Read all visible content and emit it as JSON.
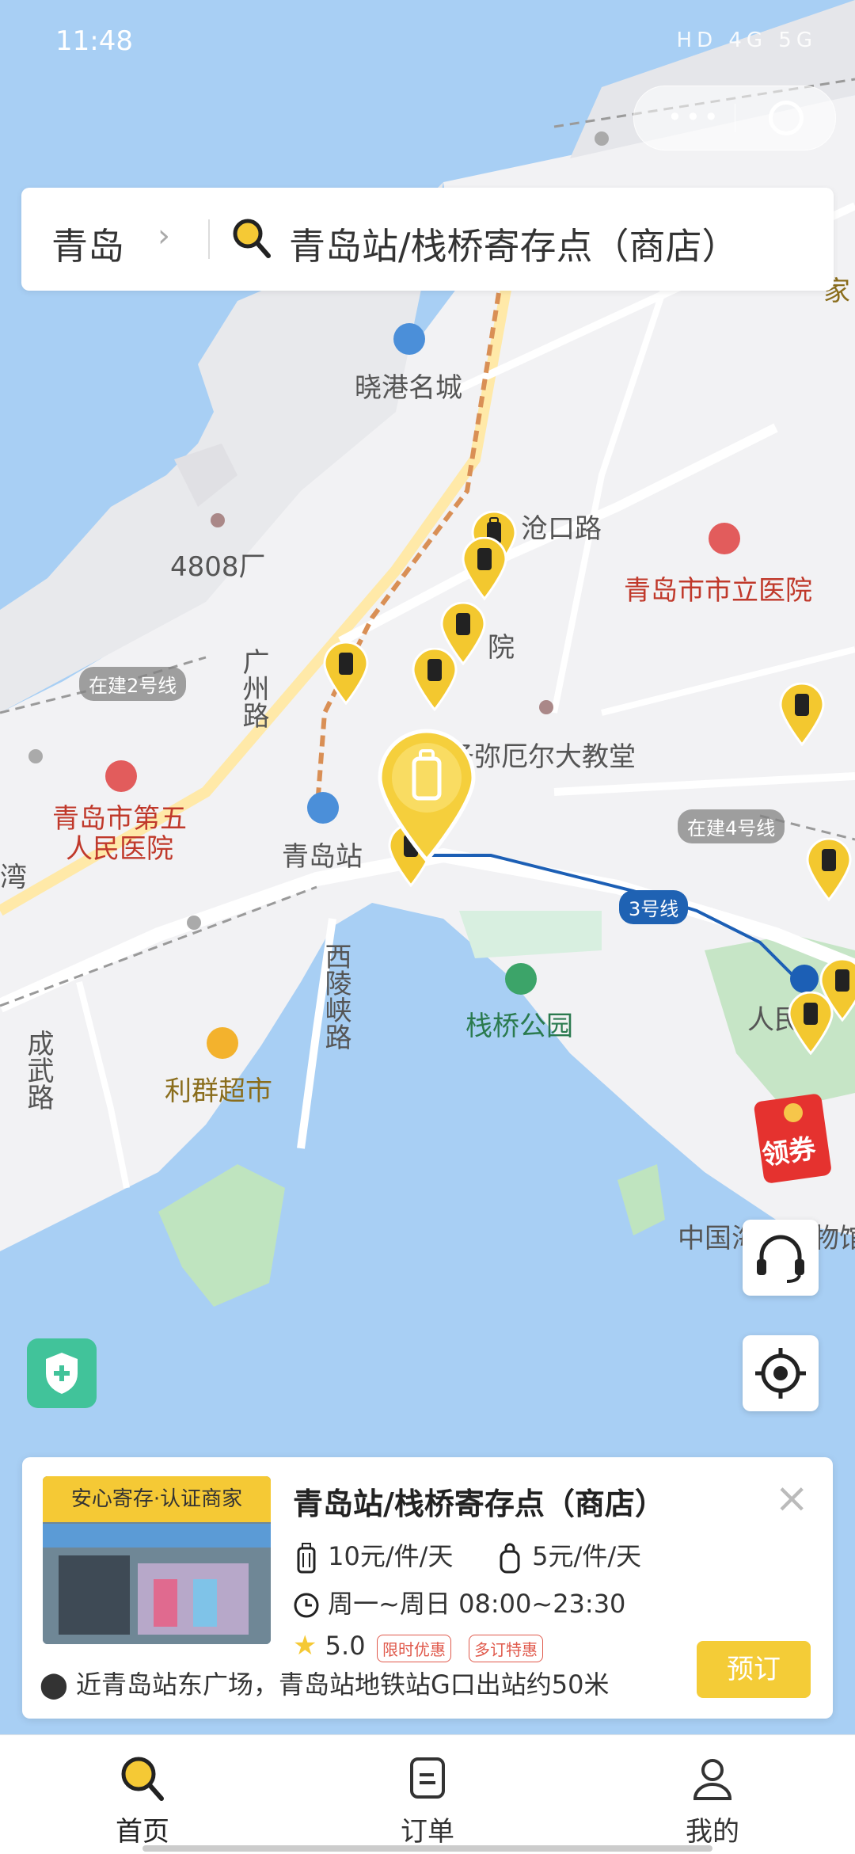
{
  "status_bar": {
    "time": "11:48",
    "indicators": "HD 4G 5G"
  },
  "capsule": {
    "more_icon": "more-dots-icon",
    "close_icon": "target-ring-icon"
  },
  "search": {
    "city": "青岛",
    "query": "青岛站/栈桥寄存点（商店）"
  },
  "map": {
    "labels": {
      "xiaogang": "晓港名城",
      "factory": "4808厂",
      "canglu": "沧口路",
      "hospital_city": "青岛市市立医院",
      "line2": "在建2号线",
      "guangzhou_rd": "广州路",
      "yuan": "院",
      "church": "圣弥厄尔大教堂",
      "hospital5": "青岛市第五\n人民医院",
      "station": "青岛站",
      "line4": "在建4号线",
      "line3": "3号线",
      "xiling": "西陵峡路",
      "park": "栈桥公园",
      "renmin": "人民",
      "chengwu": "成武路",
      "liqun": "利群超市",
      "museum": "中国海军博物馆",
      "jiangong": "家",
      "wan": "湾"
    }
  },
  "red_packet": {
    "label": "领券"
  },
  "controls": {
    "support_icon": "headset-icon",
    "locate_icon": "locate-icon",
    "safety_icon": "shield-plus-icon"
  },
  "card": {
    "badge": "安心寄存·认证商家",
    "title": "青岛站/栈桥寄存点（商店）",
    "price_luggage": "10元/件/天",
    "price_bag": "5元/件/天",
    "hours": "周一~周日 08:00~23:30",
    "rating": "5.0",
    "tags": [
      "限时优惠",
      "多订特惠"
    ],
    "address": "近青岛站东广场，青岛站地铁站G口出站约50米",
    "book": "预订"
  },
  "tabs": [
    {
      "label": "首页",
      "icon": "search-icon",
      "active": true
    },
    {
      "label": "订单",
      "icon": "order-icon",
      "active": false
    },
    {
      "label": "我的",
      "icon": "user-icon",
      "active": false
    }
  ]
}
